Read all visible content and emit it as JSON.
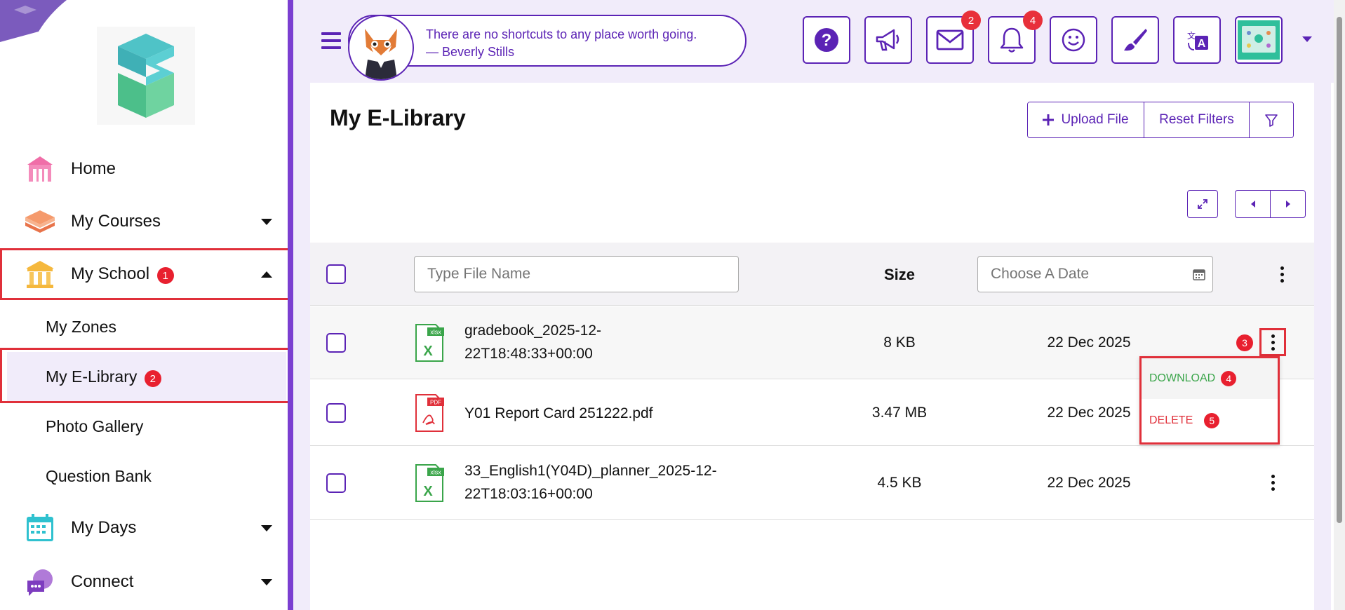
{
  "sidebar": {
    "items": [
      {
        "label": "Home"
      },
      {
        "label": "My Courses"
      },
      {
        "label": "My School",
        "badge": "1"
      },
      {
        "label": "My Days"
      },
      {
        "label": "Connect"
      }
    ],
    "sub_items": [
      {
        "label": "My Zones"
      },
      {
        "label": "My E-Library",
        "badge": "2"
      },
      {
        "label": "Photo Gallery"
      },
      {
        "label": "Question Bank"
      }
    ]
  },
  "topbar": {
    "quote_line1": "There are no shortcuts to any place worth going.",
    "quote_line2": "— Beverly Stills",
    "messages_badge": "2",
    "notifications_badge": "4"
  },
  "page": {
    "title": "My E-Library",
    "upload_label": "Upload File",
    "reset_label": "Reset Filters"
  },
  "table": {
    "search_placeholder": "Type File Name",
    "size_header": "Size",
    "date_placeholder": "Choose A Date",
    "rows": [
      {
        "name_line1": "gradebook_2025-12-",
        "name_line2": "22T18:48:33+00:00",
        "type": "xlsx",
        "size": "8 KB",
        "date": "22 Dec 2025",
        "badge": "3"
      },
      {
        "name_line1": "Y01 Report Card 251222.pdf",
        "name_line2": "",
        "type": "PDF",
        "size": "3.47 MB",
        "date": "22 Dec 2025"
      },
      {
        "name_line1": "33_English1(Y04D)_planner_2025-12-",
        "name_line2": "22T18:03:16+00:00",
        "type": "xlsx",
        "size": "4.5 KB",
        "date": "22 Dec 2025"
      }
    ]
  },
  "dropdown": {
    "download_label": "DOWNLOAD",
    "download_badge": "4",
    "delete_label": "DELETE",
    "delete_badge": "5"
  },
  "colors": {
    "accent": "#5b23b5",
    "sidebar_border": "#7b3fd1",
    "badge_red": "#e8202f",
    "excel_green": "#3aa54a",
    "pdf_red": "#e0303a"
  }
}
